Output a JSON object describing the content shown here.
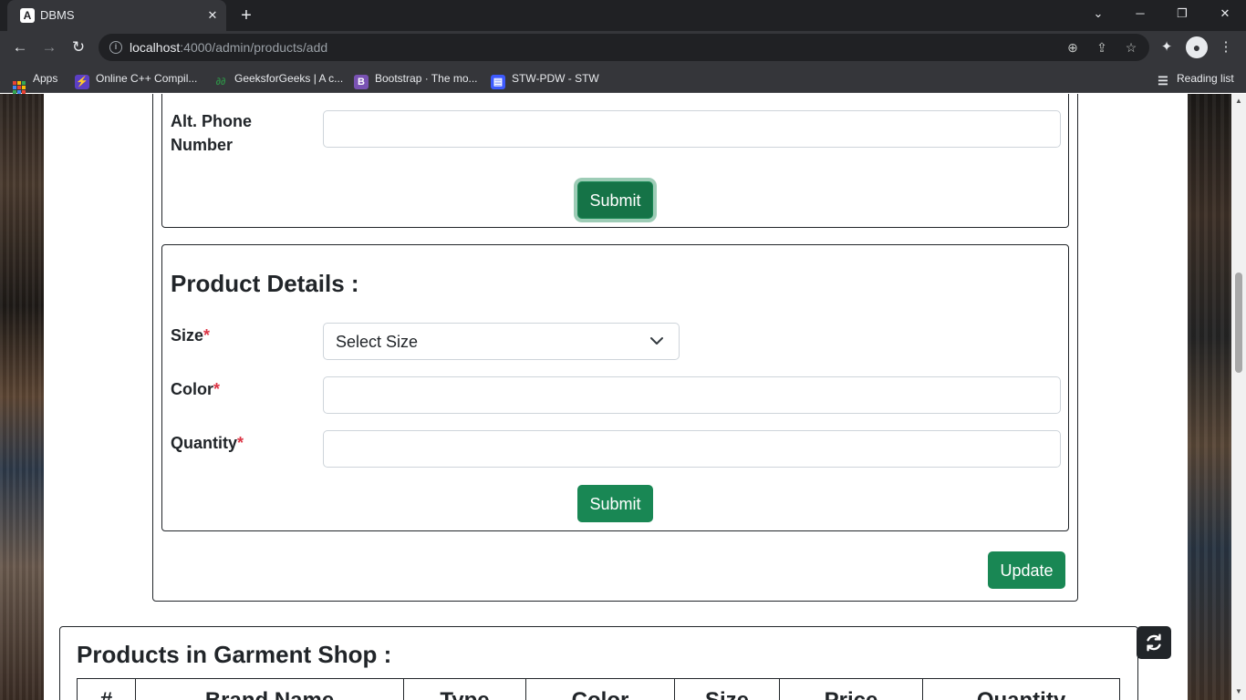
{
  "browser": {
    "tab_title": "DBMS",
    "tab_favicon": "A",
    "url_host": "localhost",
    "url_path": ":4000/admin/products/add",
    "bookmarks": [
      {
        "label": "Apps",
        "icon": "apps-grid-icon"
      },
      {
        "label": "Online C++ Compil...",
        "icon": "lightning-icon"
      },
      {
        "label": "GeeksforGeeks | A c...",
        "icon": "gfg-icon"
      },
      {
        "label": "Bootstrap · The mo...",
        "icon": "bootstrap-icon",
        "icon_text": "B"
      },
      {
        "label": "STW-PDW - STW",
        "icon": "stw-icon"
      }
    ],
    "reading_list": "Reading list"
  },
  "contact_form": {
    "alt_phone_label_line1": "Alt. Phone",
    "alt_phone_label_line2": "Number",
    "alt_phone_value": "",
    "submit_label": "Submit"
  },
  "product_details": {
    "heading": "Product Details :",
    "size_label": "Size",
    "size_selected": "Select Size",
    "color_label": "Color",
    "color_value": "",
    "quantity_label": "Quantity",
    "quantity_value": "",
    "required_marker": "*",
    "submit_label": "Submit"
  },
  "update_label": "Update",
  "products_table": {
    "title": "Products in Garment Shop :",
    "columns": [
      "#",
      "Brand Name",
      "Type",
      "Color",
      "Size",
      "Price",
      "Quantity"
    ]
  },
  "colors": {
    "success": "#198754",
    "required": "#dc3545",
    "dark": "#212529"
  }
}
